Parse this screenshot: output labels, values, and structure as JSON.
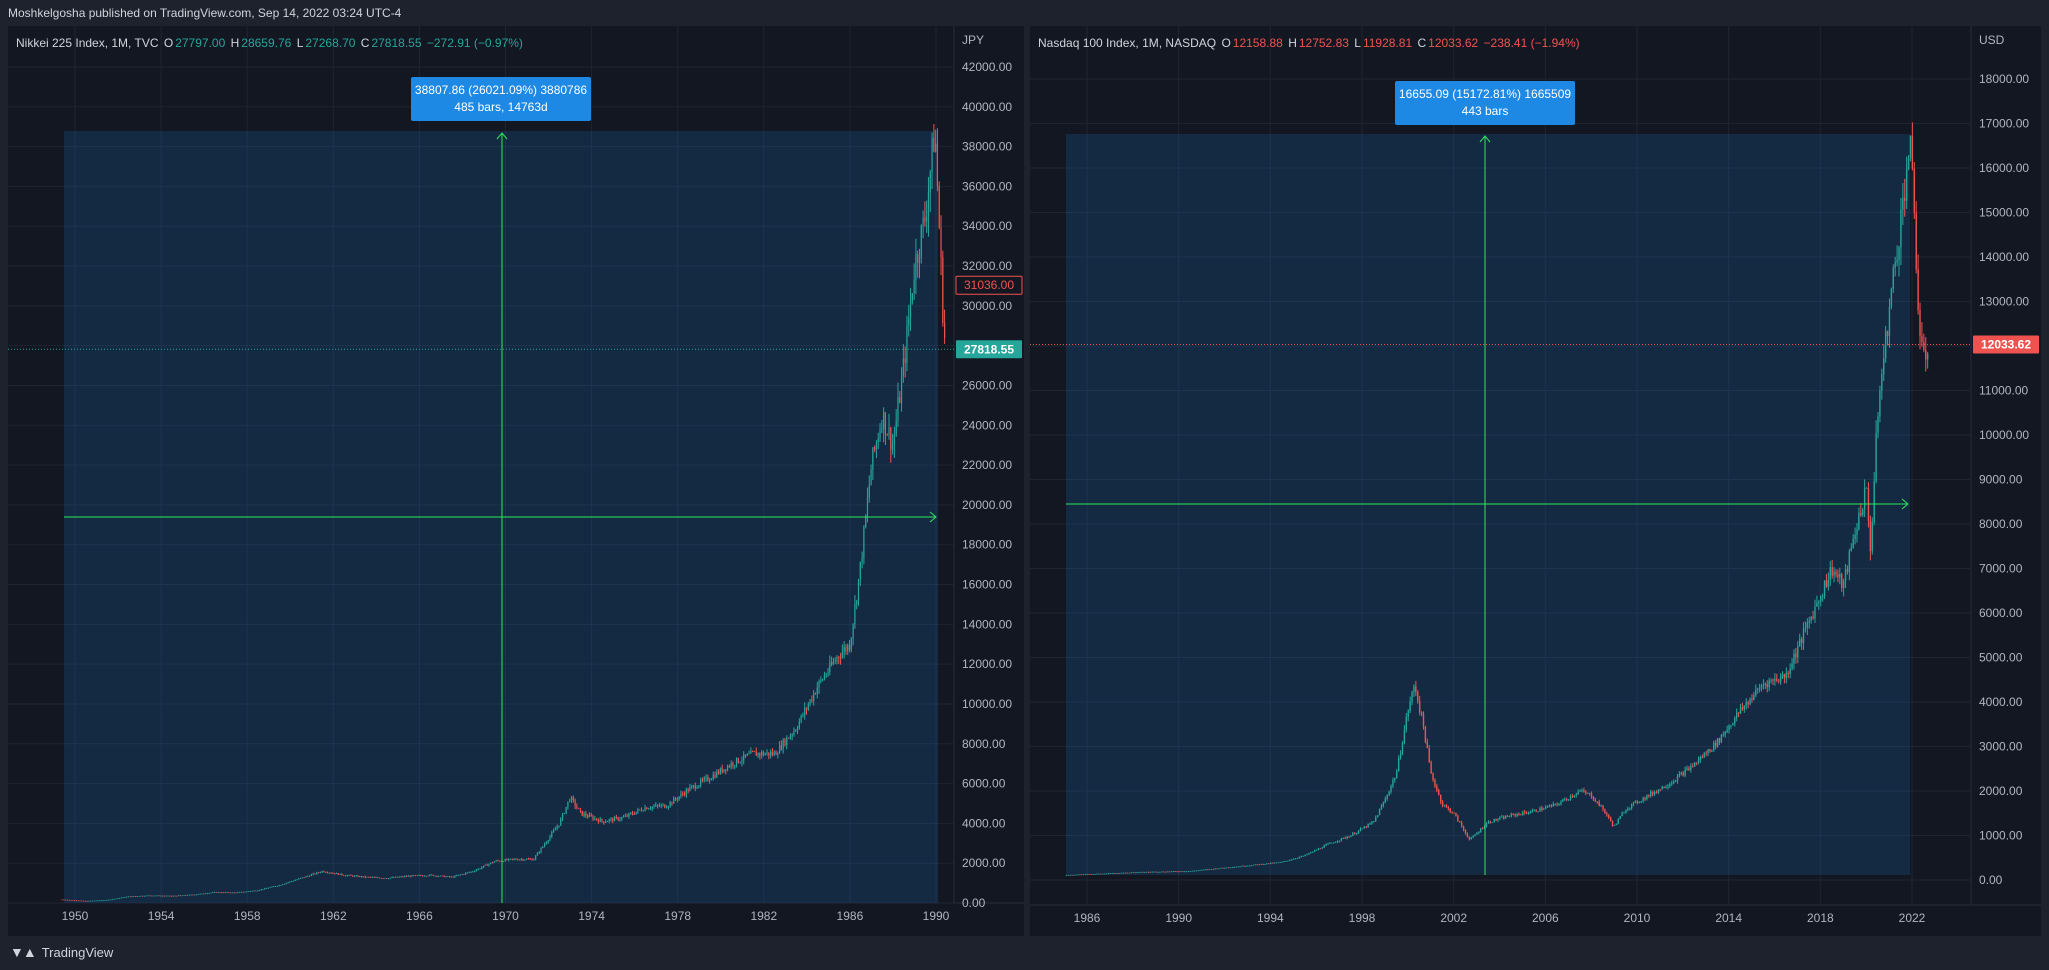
{
  "publisher": "Moshkelgosha published on TradingView.com, Sep 14, 2022 03:24 UTC-4",
  "brand": "TradingView",
  "colors": {
    "up": "#26a69a",
    "down": "#ef5350",
    "measure": "#1e88e5",
    "cross": "#2ee65b"
  },
  "chart_data": [
    {
      "type": "candlestick",
      "legend": {
        "name": "Nikkei 225 Index, 1M, TVC",
        "o_lbl": "O",
        "o": "27797.00",
        "h_lbl": "H",
        "h": "28659.76",
        "l_lbl": "L",
        "l": "27268.70",
        "c_lbl": "C",
        "c": "27818.55",
        "chg": "−272.91 (−0.97%)"
      },
      "currency": "JPY",
      "y_ticks": [
        "0.00",
        "2000.00",
        "4000.00",
        "6000.00",
        "8000.00",
        "10000.00",
        "12000.00",
        "14000.00",
        "16000.00",
        "18000.00",
        "20000.00",
        "22000.00",
        "24000.00",
        "26000.00",
        "28000.00",
        "30000.00",
        "32000.00",
        "34000.00",
        "36000.00",
        "38000.00",
        "40000.00",
        "42000.00"
      ],
      "x_ticks": [
        "1950",
        "1954",
        "1958",
        "1962",
        "1966",
        "1970",
        "1974",
        "1978",
        "1982",
        "1986",
        "1990"
      ],
      "price_labels": {
        "last": "27818.55",
        "marker": "31036.00"
      },
      "measure": {
        "line1": "38807.86 (26021.09%) 3880786",
        "line2": "485 bars, 14763d"
      },
      "series": [
        [
          1949.4,
          176
        ],
        [
          1950.5,
          102
        ],
        [
          1951.5,
          150
        ],
        [
          1952.5,
          330
        ],
        [
          1953.5,
          380
        ],
        [
          1954.5,
          355
        ],
        [
          1955.5,
          420
        ],
        [
          1956.5,
          540
        ],
        [
          1957.5,
          520
        ],
        [
          1958.5,
          640
        ],
        [
          1959.5,
          900
        ],
        [
          1960.5,
          1250
        ],
        [
          1961.5,
          1600
        ],
        [
          1962.5,
          1400
        ],
        [
          1963.5,
          1300
        ],
        [
          1964.5,
          1250
        ],
        [
          1965.5,
          1350
        ],
        [
          1966.5,
          1400
        ],
        [
          1967.5,
          1300
        ],
        [
          1968.5,
          1600
        ],
        [
          1969.5,
          2100
        ],
        [
          1970.5,
          2200
        ],
        [
          1971.3,
          2200
        ],
        [
          1972.5,
          4000
        ],
        [
          1973.0,
          5300
        ],
        [
          1973.5,
          4500
        ],
        [
          1974.5,
          4100
        ],
        [
          1975.5,
          4300
        ],
        [
          1976.5,
          4800
        ],
        [
          1977.5,
          4900
        ],
        [
          1978.5,
          5700
        ],
        [
          1979.5,
          6300
        ],
        [
          1980.5,
          7000
        ],
        [
          1981.5,
          7500
        ],
        [
          1982.5,
          7500
        ],
        [
          1983.5,
          8800
        ],
        [
          1984.5,
          10900
        ],
        [
          1985.5,
          12500
        ],
        [
          1986.0,
          13000
        ],
        [
          1986.5,
          17000
        ],
        [
          1987.0,
          22000
        ],
        [
          1987.5,
          24500
        ],
        [
          1988.0,
          23000
        ],
        [
          1988.5,
          27000
        ],
        [
          1989.0,
          32000
        ],
        [
          1989.5,
          34500
        ],
        [
          1989.95,
          38900
        ],
        [
          1990.15,
          34000
        ],
        [
          1990.35,
          29000
        ],
        [
          1990.45,
          27818
        ]
      ]
    },
    {
      "type": "candlestick",
      "legend": {
        "name": "Nasdaq 100 Index, 1M, NASDAQ",
        "o_lbl": "O",
        "o": "12158.88",
        "h_lbl": "H",
        "h": "12752.83",
        "l_lbl": "L",
        "l": "11928.81",
        "c_lbl": "C",
        "c": "12033.62",
        "chg": "−238.41 (−1.94%)"
      },
      "currency": "USD",
      "y_ticks": [
        "0.00",
        "1000.00",
        "2000.00",
        "3000.00",
        "4000.00",
        "5000.00",
        "6000.00",
        "7000.00",
        "8000.00",
        "9000.00",
        "10000.00",
        "11000.00",
        "12000.00",
        "13000.00",
        "14000.00",
        "15000.00",
        "16000.00",
        "17000.00",
        "18000.00"
      ],
      "x_ticks": [
        "1986",
        "1990",
        "1994",
        "1998",
        "2002",
        "2006",
        "2010",
        "2014",
        "2018",
        "2022"
      ],
      "price_labels": {
        "last": "12033.62"
      },
      "measure": {
        "line1": "16655.09 (15172.81%) 1665509",
        "line2": "443 bars"
      },
      "series": [
        [
          1985.1,
          110
        ],
        [
          1986.5,
          140
        ],
        [
          1988.5,
          180
        ],
        [
          1990.5,
          200
        ],
        [
          1992.5,
          300
        ],
        [
          1994.5,
          400
        ],
        [
          1995.5,
          550
        ],
        [
          1996.5,
          800
        ],
        [
          1997.5,
          1000
        ],
        [
          1998.5,
          1300
        ],
        [
          1999.0,
          1800
        ],
        [
          1999.5,
          2400
        ],
        [
          2000.0,
          3800
        ],
        [
          2000.3,
          4400
        ],
        [
          2000.7,
          3400
        ],
        [
          2001.0,
          2400
        ],
        [
          2001.5,
          1700
        ],
        [
          2002.0,
          1500
        ],
        [
          2002.7,
          900
        ],
        [
          2003.5,
          1300
        ],
        [
          2004.5,
          1450
        ],
        [
          2005.5,
          1550
        ],
        [
          2006.5,
          1700
        ],
        [
          2007.5,
          2000
        ],
        [
          2008.0,
          1900
        ],
        [
          2008.5,
          1600
        ],
        [
          2009.0,
          1200
        ],
        [
          2009.5,
          1600
        ],
        [
          2010.5,
          1900
        ],
        [
          2011.5,
          2200
        ],
        [
          2012.5,
          2600
        ],
        [
          2013.5,
          3100
        ],
        [
          2014.5,
          3800
        ],
        [
          2015.5,
          4400
        ],
        [
          2016.5,
          4600
        ],
        [
          2017.5,
          5800
        ],
        [
          2018.5,
          7000
        ],
        [
          2019.0,
          6600
        ],
        [
          2019.5,
          7800
        ],
        [
          2020.0,
          8800
        ],
        [
          2020.2,
          7400
        ],
        [
          2020.5,
          10500
        ],
        [
          2021.0,
          12800
        ],
        [
          2021.5,
          14800
        ],
        [
          2021.9,
          16600
        ],
        [
          2022.1,
          15000
        ],
        [
          2022.3,
          12500
        ],
        [
          2022.5,
          11600
        ],
        [
          2022.7,
          12033
        ]
      ]
    }
  ]
}
